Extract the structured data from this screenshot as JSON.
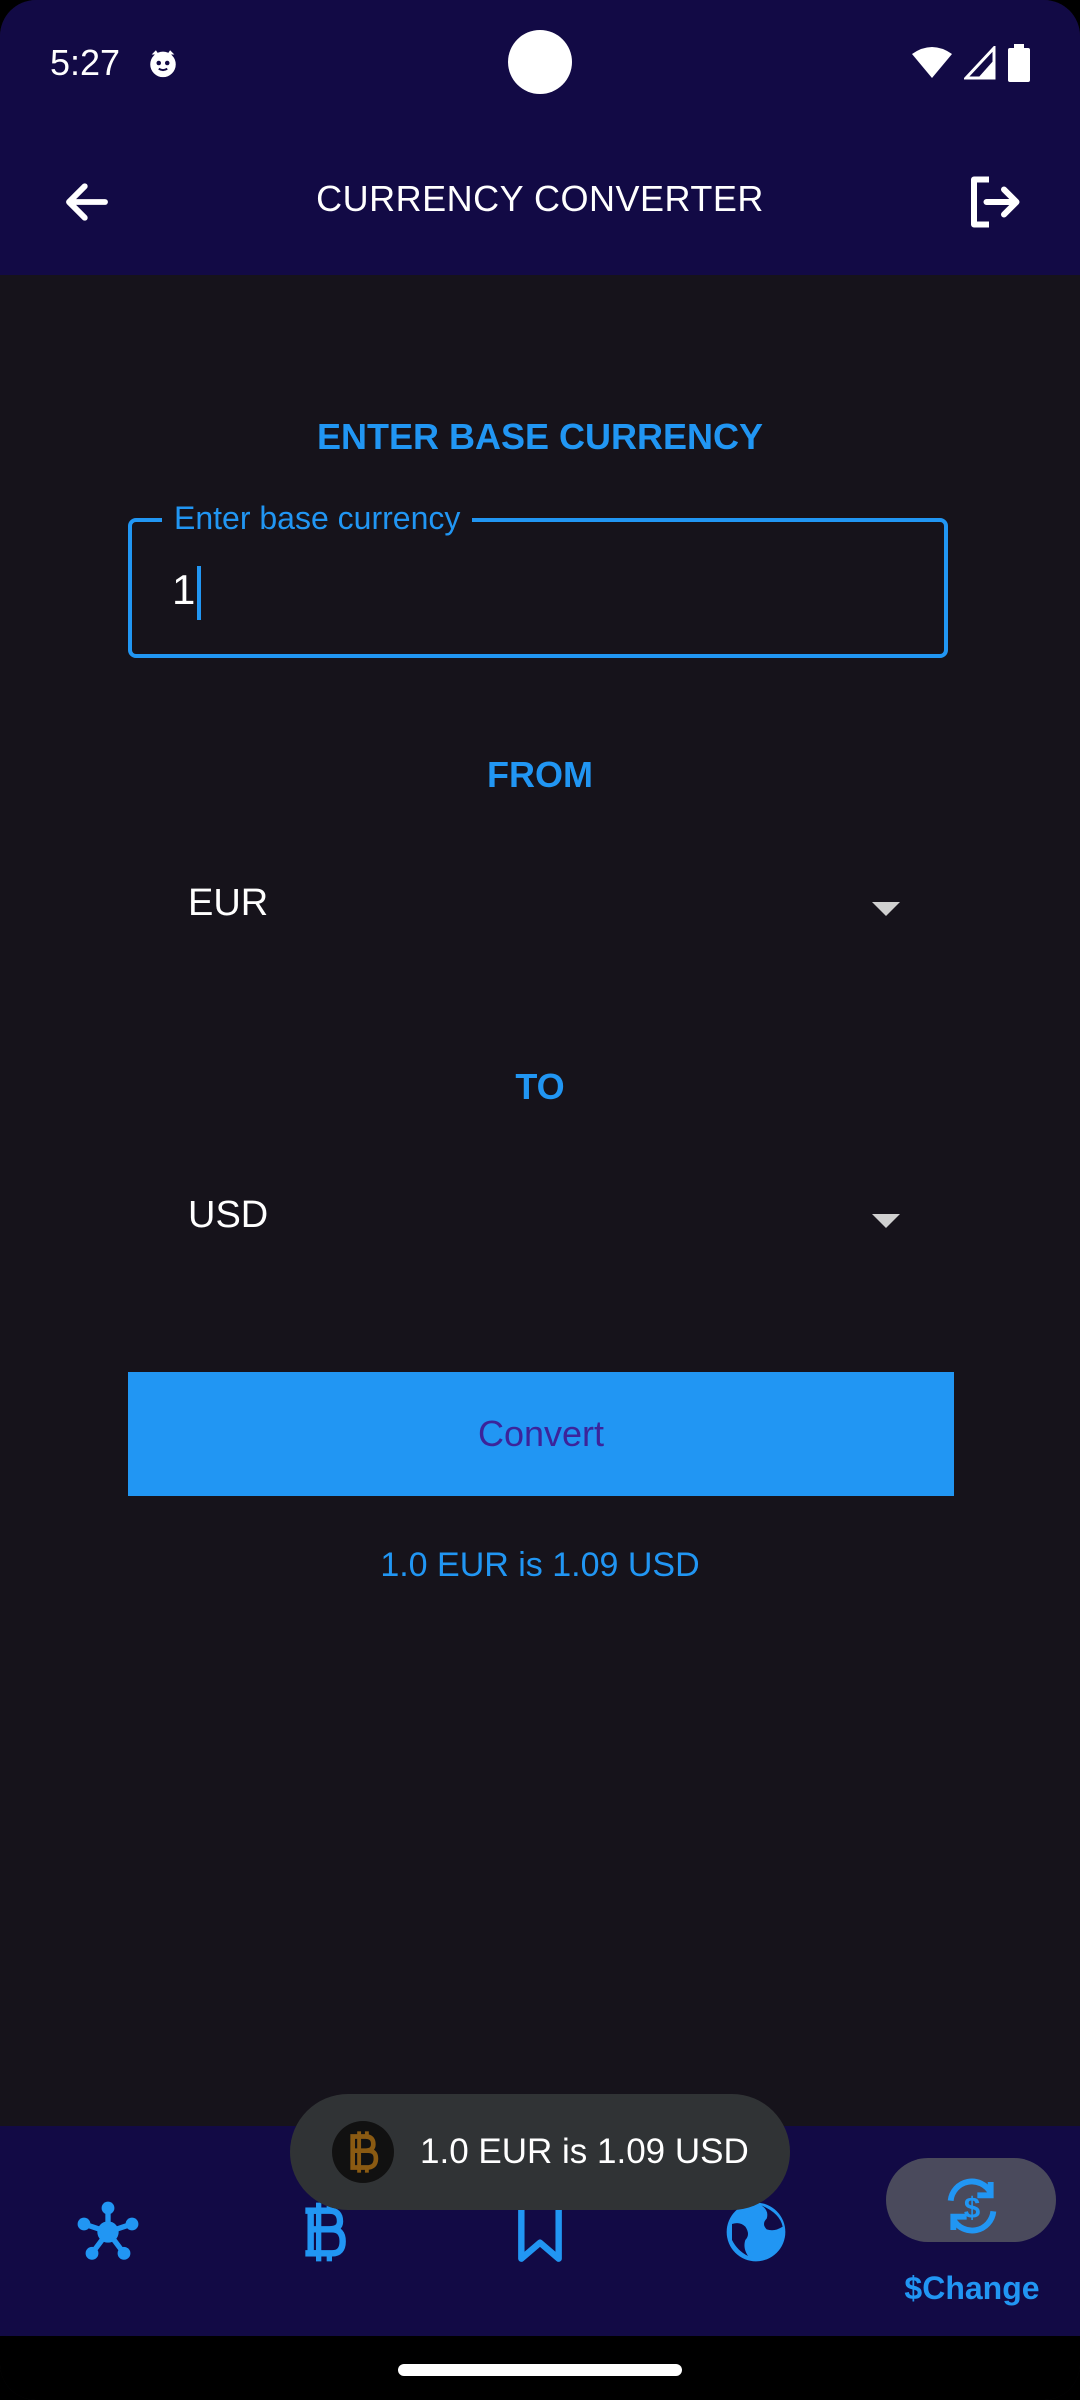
{
  "status_bar": {
    "time": "5:27"
  },
  "app_bar": {
    "title": "CURRENCY CONVERTER"
  },
  "form": {
    "base_heading": "ENTER BASE CURRENCY",
    "base_field_label": "Enter base currency",
    "base_field_value": "1",
    "from_heading": "FROM",
    "from_value": "EUR",
    "to_heading": "TO",
    "to_value": "USD",
    "convert_label": "Convert",
    "result": "1.0 EUR is 1.09 USD"
  },
  "toast": {
    "text": "1.0 EUR is 1.09 USD",
    "icon": "bitcoin-icon"
  },
  "bottom_nav": {
    "items": [
      {
        "icon": "network-icon"
      },
      {
        "icon": "bitcoin-icon"
      },
      {
        "icon": "bookmark-icon"
      },
      {
        "icon": "globe-icon"
      },
      {
        "icon": "currency-exchange-icon",
        "label": "$Change",
        "active": true
      }
    ]
  },
  "colors": {
    "accent": "#2196f3",
    "bar_background": "#120a45",
    "screen_background": "#16131b",
    "button_text": "#3c249a",
    "toast_background": "#303335",
    "active_pill": "#4a4a5c"
  }
}
